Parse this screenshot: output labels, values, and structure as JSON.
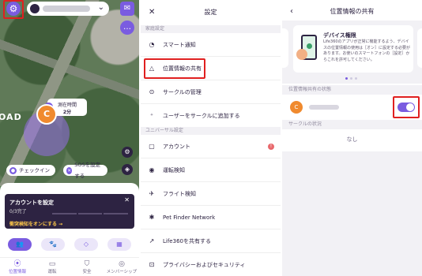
{
  "panel1": {
    "road_label": "OAD",
    "arrival_label": "測在時間",
    "arrival_time": "2分",
    "member_initial": "C",
    "checkin_label": "チェックイン",
    "sos_label": "SOSを設定する",
    "setup": {
      "title": "アカウントを設定",
      "progress": "0/3完了",
      "link": "衝突検知をオンにする →"
    },
    "nav": [
      {
        "icon": "location-pin-icon",
        "label": "位置情報"
      },
      {
        "icon": "car-icon",
        "label": "運転"
      },
      {
        "icon": "shield-icon",
        "label": "安全"
      },
      {
        "icon": "membership-icon",
        "label": "メンバーシップ"
      }
    ],
    "accent_color": "#7a5ce0"
  },
  "panel2": {
    "title": "設定",
    "section_family": "家庭設定",
    "section_universal": "ユニバーサル設定",
    "items": [
      {
        "icon": "bell-icon",
        "label": "スマート通知"
      },
      {
        "icon": "location-share-icon",
        "label": "位置情報の共有"
      },
      {
        "icon": "circle-manage-icon",
        "label": "サークルの管理"
      },
      {
        "icon": "add-user-icon",
        "label": "ユーザーをサークルに追加する"
      },
      {
        "icon": "account-icon",
        "label": "アカウント"
      },
      {
        "icon": "steering-icon",
        "label": "運転検知"
      },
      {
        "icon": "plane-icon",
        "label": "フライト検知"
      },
      {
        "icon": "pet-icon",
        "label": "Pet Finder Network"
      },
      {
        "icon": "share-icon",
        "label": "Life360を共有する"
      },
      {
        "icon": "lock-icon",
        "label": "プライバシーおよびセキュリティ"
      }
    ],
    "account_badge": "!"
  },
  "panel3": {
    "title": "位置情報の共有",
    "card_title": "デバイス権限",
    "card_body": "Life360のアプリが正常に機能するよう、デバイスの位置情報の使用は［オン］に設定する必要があります。お使いのスマートフォンの［設定］からこれを許可してください。",
    "section_status": "位置情報共有の状態",
    "member_initial": "C",
    "section_circle": "サークルの状況",
    "none_text": "なし",
    "toggle_on": "on"
  }
}
